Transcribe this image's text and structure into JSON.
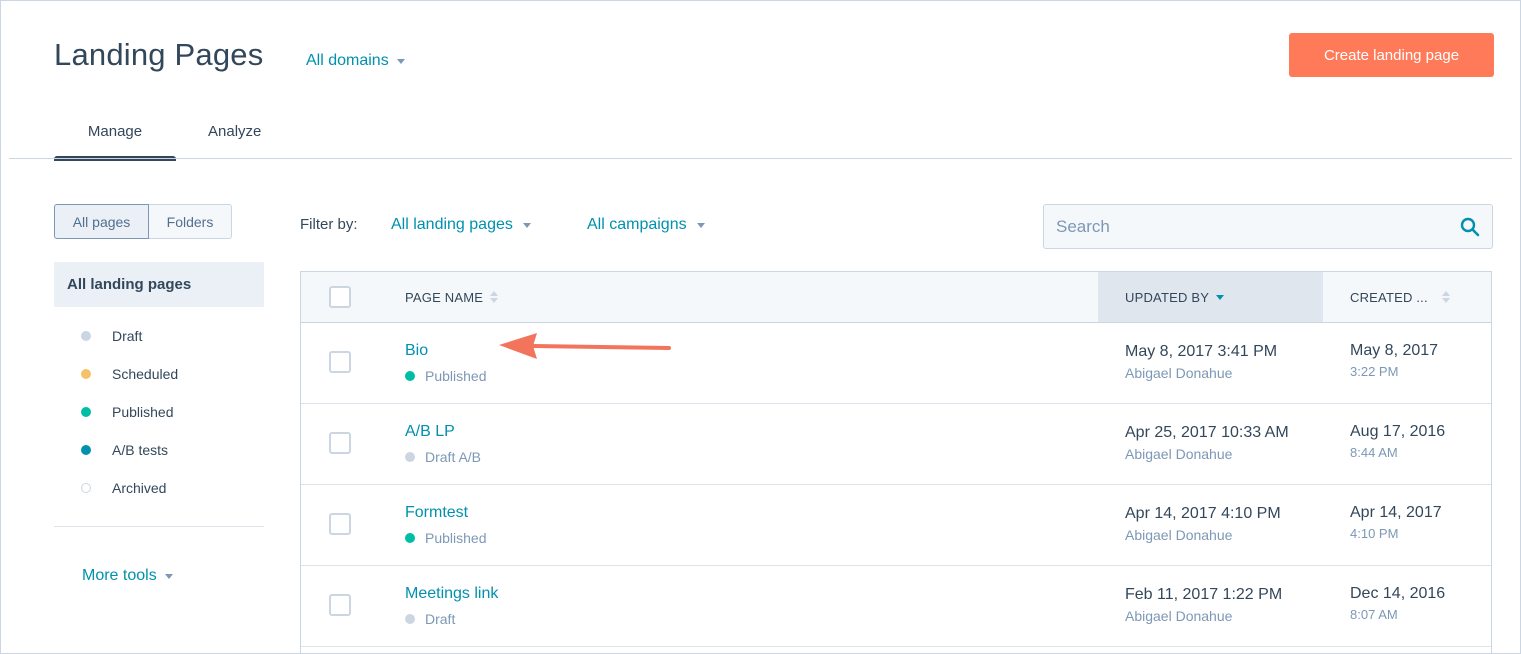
{
  "header": {
    "title": "Landing Pages",
    "domain_filter": "All domains",
    "create_button": "Create landing page"
  },
  "tabs": [
    {
      "label": "Manage",
      "active": true
    },
    {
      "label": "Analyze",
      "active": false
    }
  ],
  "view_toggle": {
    "pages": "All pages",
    "folders": "Folders"
  },
  "sidebar": {
    "all_label": "All landing pages",
    "items": [
      {
        "label": "Draft",
        "color": "#cbd6e2"
      },
      {
        "label": "Scheduled",
        "color": "#f5c26b"
      },
      {
        "label": "Published",
        "color": "#00bda5"
      },
      {
        "label": "A/B tests",
        "color": "#0091ae"
      },
      {
        "label": "Archived",
        "color": "#ffffff"
      }
    ],
    "more_tools": "More tools"
  },
  "filters": {
    "label": "Filter by:",
    "pages": "All landing pages",
    "campaigns": "All campaigns",
    "search_placeholder": "Search"
  },
  "table": {
    "columns": {
      "name": "PAGE NAME",
      "updated": "UPDATED BY",
      "created": "CREATED ..."
    },
    "rows": [
      {
        "name": "Bio",
        "status": "Published",
        "status_color": "#00bda5",
        "updated": "May 8, 2017 3:41 PM",
        "updated_by": "Abigael Donahue",
        "created_date": "May 8, 2017",
        "created_time": "3:22 PM"
      },
      {
        "name": "A/B LP",
        "status": "Draft A/B",
        "status_color": "#cbd6e2",
        "updated": "Apr 25, 2017 10:33 AM",
        "updated_by": "Abigael Donahue",
        "created_date": "Aug 17, 2016",
        "created_time": "8:44 AM"
      },
      {
        "name": "Formtest",
        "status": "Published",
        "status_color": "#00bda5",
        "updated": "Apr 14, 2017 4:10 PM",
        "updated_by": "Abigael Donahue",
        "created_date": "Apr 14, 2017",
        "created_time": "4:10 PM"
      },
      {
        "name": "Meetings link",
        "status": "Draft",
        "status_color": "#cbd6e2",
        "updated": "Feb 11, 2017 1:22 PM",
        "updated_by": "Abigael Donahue",
        "created_date": "Dec 14, 2016",
        "created_time": "8:07 AM"
      }
    ]
  },
  "colors": {
    "accent": "#0091ae",
    "primary_button": "#ff7a59",
    "annotation_arrow": "#f2745c"
  }
}
